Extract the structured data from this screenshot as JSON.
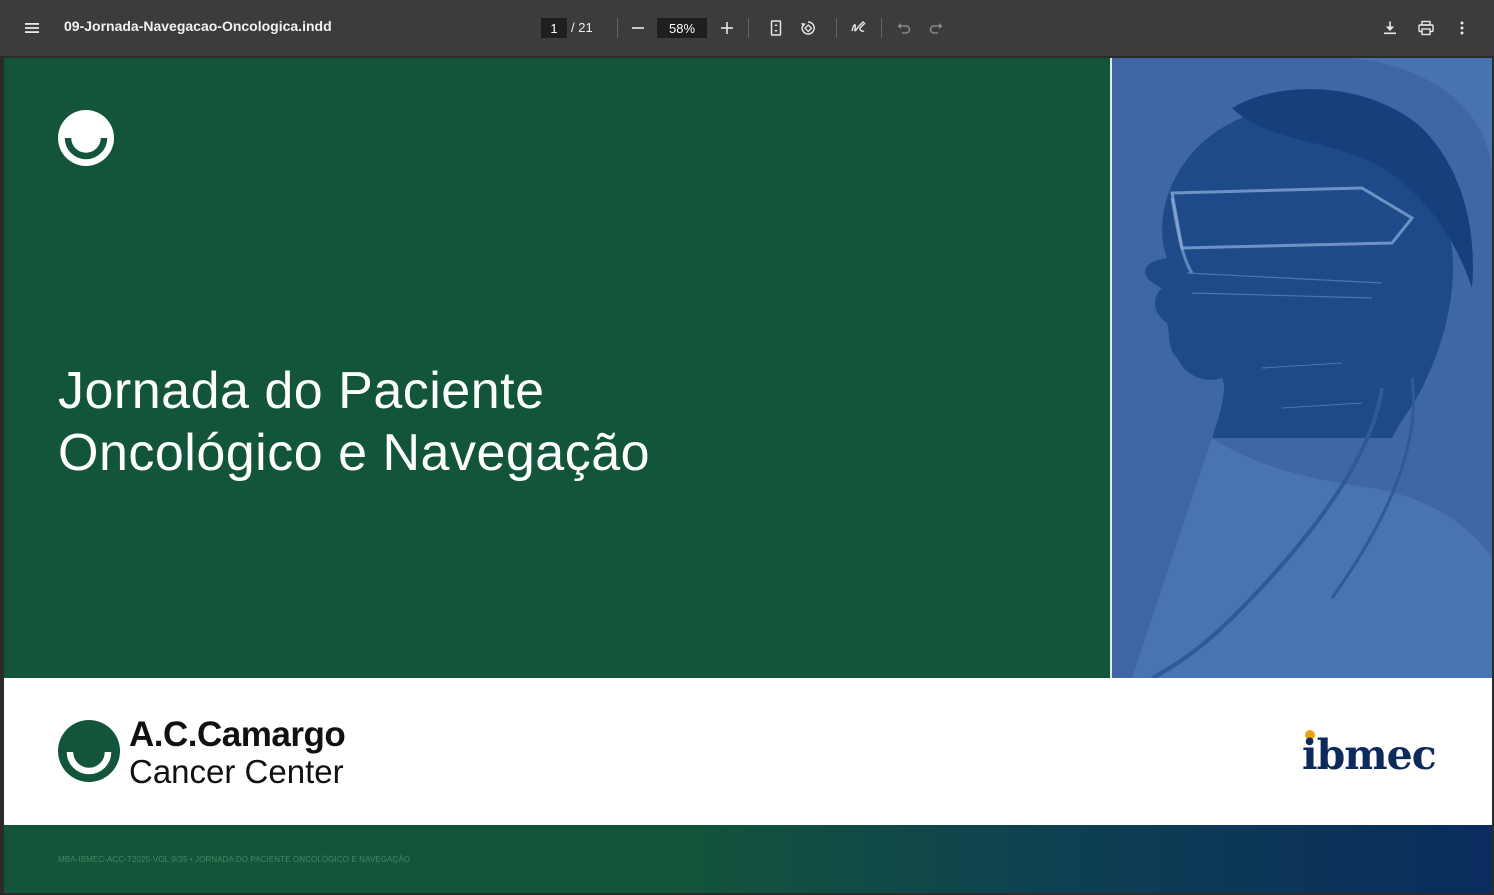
{
  "viewer": {
    "filename": "09-Jornada-Navegacao-Oncologica.indd",
    "current_page": "1",
    "page_separator": "/ 21",
    "zoom": "58%",
    "icons": {
      "menu": "hamburger-menu-icon",
      "zoom_out": "minus-icon",
      "zoom_in": "plus-icon",
      "fit_page": "fit-page-icon",
      "rotate": "rotate-icon",
      "annotate": "pen-icon",
      "undo": "undo-icon",
      "redo": "redo-icon",
      "download": "download-icon",
      "print": "print-icon",
      "more": "more-vertical-icon"
    }
  },
  "document": {
    "title_line1": "Jornada do Paciente",
    "title_line2": "Oncológico e Navegação",
    "acc_name": "A.C.Camargo",
    "acc_sub": "Cancer Center",
    "ibmec": "ibmec",
    "footer": "MBA-IBMEC-ACC-T2025-VOL.9/35 • JORNADA DO PACIENTE ONCOLÓGICO E NAVEGAÇÃO",
    "colors": {
      "green": "#13553a",
      "photo_blue": "#3f67a6",
      "ibmec_navy": "#0e2a5c",
      "ibmec_dot": "#e8a317"
    }
  }
}
